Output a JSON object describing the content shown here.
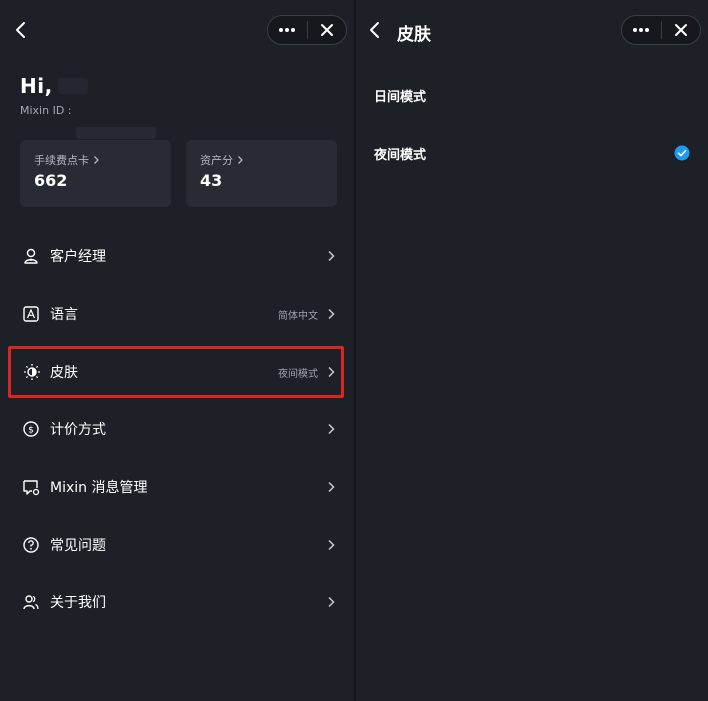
{
  "left": {
    "greeting": "Hi,",
    "mixin_id_label": "Mixin ID :",
    "cards": [
      {
        "label": "手续费点卡",
        "value": "662"
      },
      {
        "label": "资产分",
        "value": "43"
      }
    ],
    "menu": [
      {
        "label": "客户经理",
        "value": "",
        "icon": "user-manager-icon"
      },
      {
        "label": "语言",
        "value": "简体中文",
        "icon": "language-icon"
      },
      {
        "label": "皮肤",
        "value": "夜间模式",
        "icon": "sun-icon"
      },
      {
        "label": "计价方式",
        "value": "",
        "icon": "currency-icon"
      },
      {
        "label": "Mixin 消息管理",
        "value": "",
        "icon": "message-settings-icon"
      },
      {
        "label": "常见问题",
        "value": "",
        "icon": "help-icon"
      },
      {
        "label": "关于我们",
        "value": "",
        "icon": "team-icon"
      }
    ]
  },
  "right": {
    "title": "皮肤",
    "options": [
      {
        "label": "日间模式",
        "selected": false
      },
      {
        "label": "夜间模式",
        "selected": true
      }
    ]
  },
  "colors": {
    "background": "#1d2027",
    "card": "#282b33",
    "highlight_border": "#d92520",
    "check_accent": "#1e9bf0",
    "muted_text": "#9ea2ac"
  }
}
